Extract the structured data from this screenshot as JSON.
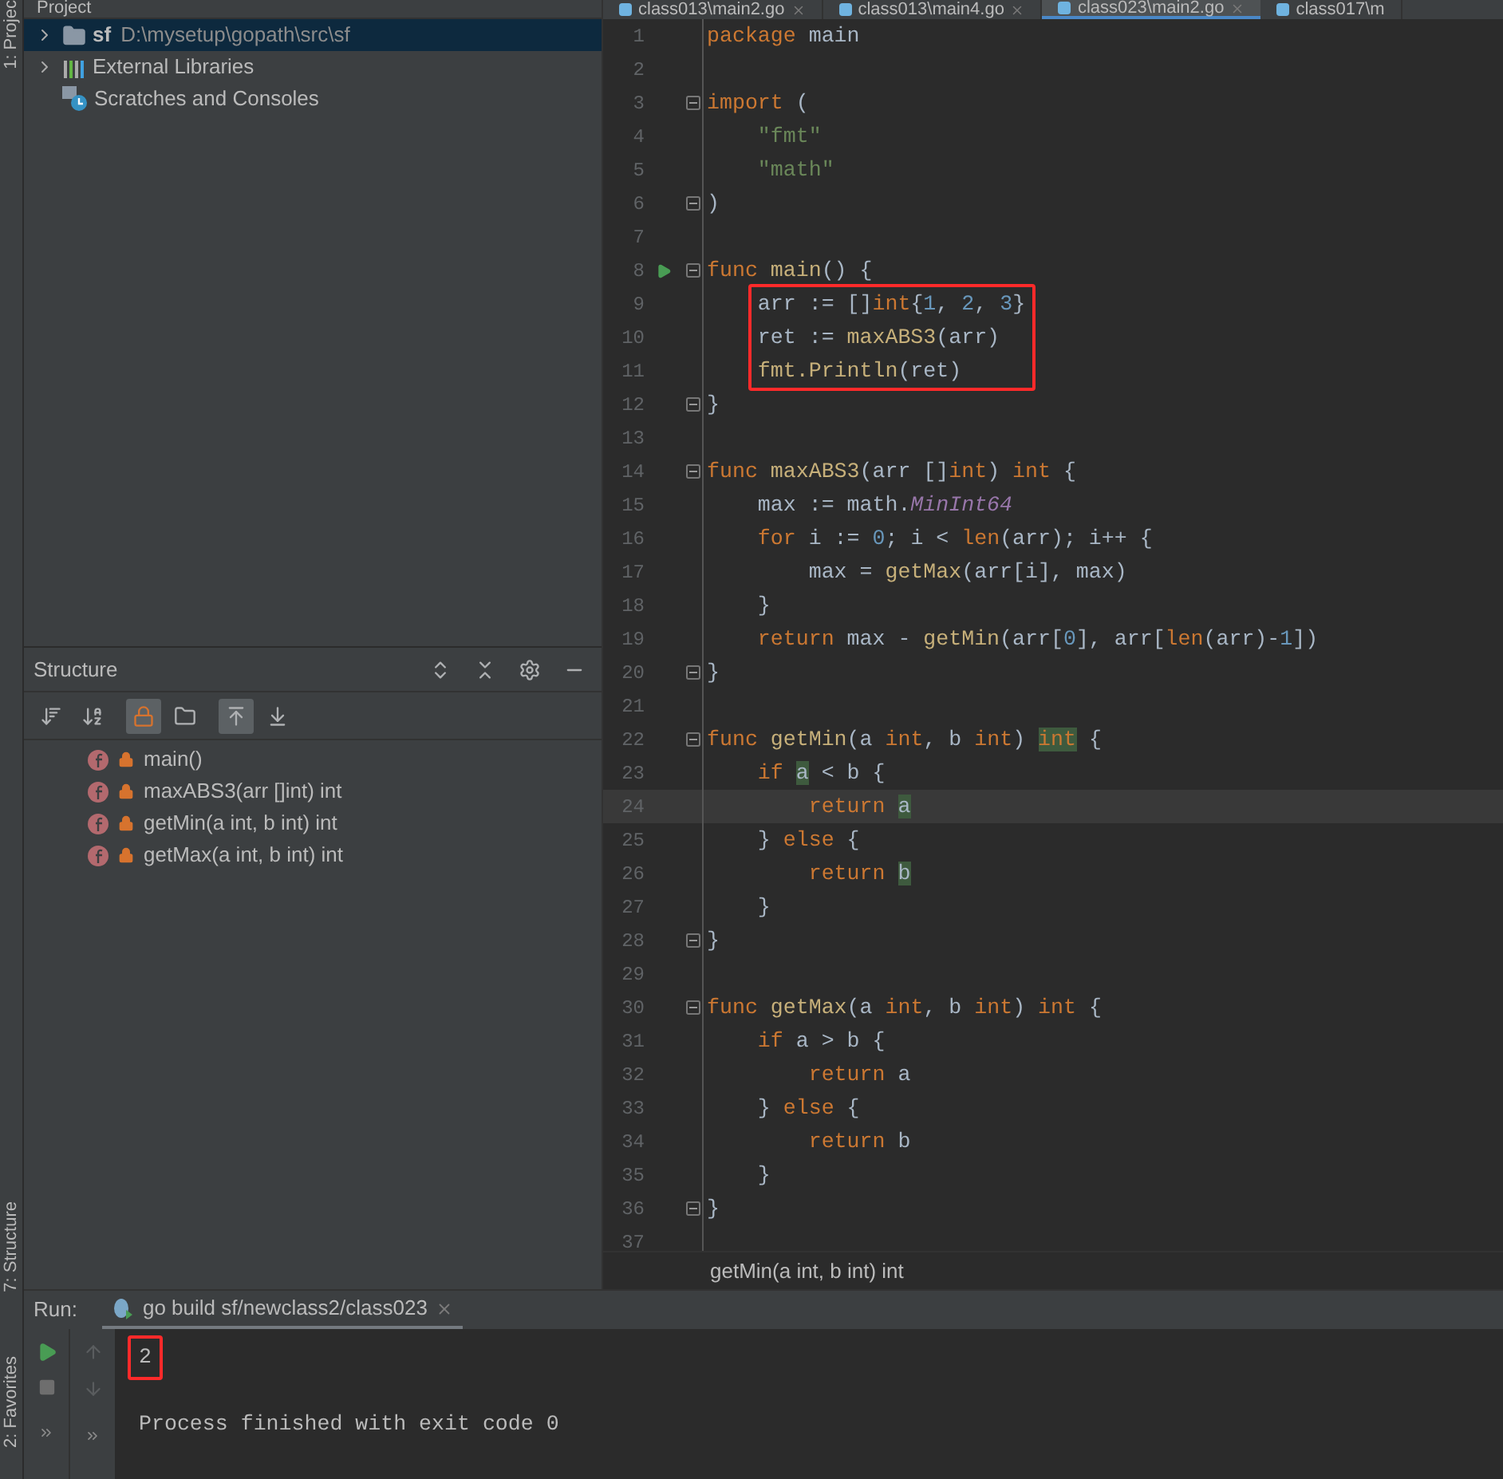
{
  "side_strip": [
    {
      "label": "1: Projec"
    },
    {
      "label": "7: Structure"
    },
    {
      "label": "2: Favorites"
    }
  ],
  "project": {
    "title": "Project",
    "tree": [
      {
        "kind": "module",
        "label": "sf",
        "path": "D:\\mysetup\\gopath\\src\\sf",
        "selected": true,
        "expandable": true
      },
      {
        "kind": "libraries",
        "label": "External Libraries",
        "selected": false,
        "expandable": true
      },
      {
        "kind": "scratches",
        "label": "Scratches and Consoles",
        "selected": false,
        "expandable": false
      }
    ]
  },
  "structure": {
    "title": "Structure",
    "toolbar": [
      {
        "kind": "sort-visibility",
        "selected": false
      },
      {
        "kind": "sort-alpha",
        "selected": false
      },
      {
        "kind": "lock",
        "selected": true
      },
      {
        "kind": "folder",
        "selected": false
      },
      {
        "kind": "scroll-from",
        "selected": true
      },
      {
        "kind": "scroll-to",
        "selected": false
      }
    ],
    "items": [
      {
        "label": "main()"
      },
      {
        "label": "maxABS3(arr []int) int"
      },
      {
        "label": "getMin(a int, b int) int"
      },
      {
        "label": "getMax(a int, b int) int"
      }
    ]
  },
  "tabs": [
    {
      "label": "class013\\main2.go",
      "selected": false
    },
    {
      "label": "class013\\main4.go",
      "selected": false
    },
    {
      "label": "class023\\main2.go",
      "selected": true
    },
    {
      "label": "class017\\m",
      "selected": false
    }
  ],
  "code": [
    {
      "num": "1",
      "tokens": [
        {
          "kind": "kw",
          "text": "package"
        },
        {
          "kind": "plain",
          "text": " main"
        }
      ]
    },
    {
      "num": "2"
    },
    {
      "num": "3",
      "fold_start": true,
      "tokens": [
        {
          "kind": "kw",
          "text": "import"
        },
        {
          "kind": "plain",
          "text": " ("
        }
      ]
    },
    {
      "num": "4",
      "tokens": [
        {
          "kind": "str",
          "text": "    \"fmt\""
        }
      ]
    },
    {
      "num": "5",
      "tokens": [
        {
          "kind": "str",
          "text": "    \"math\""
        }
      ]
    },
    {
      "num": "6",
      "fold_end": true,
      "tokens": [
        {
          "kind": "plain",
          "text": ")"
        }
      ]
    },
    {
      "num": "7"
    },
    {
      "num": "8",
      "fold_start": true,
      "run": true,
      "tokens": [
        {
          "kind": "kw",
          "text": "func "
        },
        {
          "kind": "fn",
          "text": "main"
        },
        {
          "kind": "plain",
          "text": "() {"
        }
      ]
    },
    {
      "num": "9",
      "framed": true,
      "tokens": [
        {
          "kind": "plain",
          "text": "    arr := []"
        },
        {
          "kind": "kw",
          "text": "int"
        },
        {
          "kind": "plain",
          "text": "{"
        },
        {
          "kind": "num",
          "text": "1"
        },
        {
          "kind": "plain",
          "text": ", "
        },
        {
          "kind": "num",
          "text": "2"
        },
        {
          "kind": "plain",
          "text": ", "
        },
        {
          "kind": "num",
          "text": "3"
        },
        {
          "kind": "plain",
          "text": "}"
        }
      ]
    },
    {
      "num": "10",
      "framed": true,
      "tokens": [
        {
          "kind": "plain",
          "text": "    ret := "
        },
        {
          "kind": "fn",
          "text": "maxABS3"
        },
        {
          "kind": "plain",
          "text": "(arr)"
        }
      ]
    },
    {
      "num": "11",
      "framed": true,
      "tokens": [
        {
          "kind": "fn",
          "text": "    fmt.Println"
        },
        {
          "kind": "plain",
          "text": "(ret)"
        }
      ]
    },
    {
      "num": "12",
      "fold_end": true,
      "tokens": [
        {
          "kind": "plain",
          "text": "}"
        }
      ]
    },
    {
      "num": "13"
    },
    {
      "num": "14",
      "fold_start": true,
      "tokens": [
        {
          "kind": "kw",
          "text": "func "
        },
        {
          "kind": "fn",
          "text": "maxABS3"
        },
        {
          "kind": "plain",
          "text": "(arr []"
        },
        {
          "kind": "kw",
          "text": "int"
        },
        {
          "kind": "plain",
          "text": ") "
        },
        {
          "kind": "kw",
          "text": "int"
        },
        {
          "kind": "plain",
          "text": " {"
        }
      ]
    },
    {
      "num": "15",
      "tokens": [
        {
          "kind": "plain",
          "text": "    max := math."
        },
        {
          "kind": "const",
          "text": "MinInt64"
        }
      ]
    },
    {
      "num": "16",
      "tokens": [
        {
          "kind": "kw",
          "text": "    for"
        },
        {
          "kind": "plain",
          "text": " i := "
        },
        {
          "kind": "num",
          "text": "0"
        },
        {
          "kind": "plain",
          "text": "; i < "
        },
        {
          "kind": "kw",
          "text": "len"
        },
        {
          "kind": "plain",
          "text": "(arr); i++ {"
        }
      ]
    },
    {
      "num": "17",
      "tokens": [
        {
          "kind": "plain",
          "text": "        max = "
        },
        {
          "kind": "fn",
          "text": "getMax"
        },
        {
          "kind": "plain",
          "text": "(arr[i], max)"
        }
      ]
    },
    {
      "num": "18",
      "tokens": [
        {
          "kind": "plain",
          "text": "    }"
        }
      ]
    },
    {
      "num": "19",
      "tokens": [
        {
          "kind": "kw",
          "text": "    return"
        },
        {
          "kind": "plain",
          "text": " max - "
        },
        {
          "kind": "fn",
          "text": "getMin"
        },
        {
          "kind": "plain",
          "text": "(arr["
        },
        {
          "kind": "num",
          "text": "0"
        },
        {
          "kind": "plain",
          "text": "], arr["
        },
        {
          "kind": "kw",
          "text": "len"
        },
        {
          "kind": "plain",
          "text": "(arr)-"
        },
        {
          "kind": "num",
          "text": "1"
        },
        {
          "kind": "plain",
          "text": "])"
        }
      ]
    },
    {
      "num": "20",
      "fold_end": true,
      "tokens": [
        {
          "kind": "plain",
          "text": "}"
        }
      ]
    },
    {
      "num": "21"
    },
    {
      "num": "22",
      "fold_start": true,
      "tokens": [
        {
          "kind": "kw",
          "text": "func "
        },
        {
          "kind": "fn",
          "text": "getMin"
        },
        {
          "kind": "plain",
          "text": "(a "
        },
        {
          "kind": "kw",
          "text": "int"
        },
        {
          "kind": "plain",
          "text": ", b "
        },
        {
          "kind": "kw",
          "text": "int"
        },
        {
          "kind": "plain",
          "text": ") "
        },
        {
          "kind": "kw",
          "text": "int",
          "highlighted": true
        },
        {
          "kind": "plain",
          "text": " {"
        }
      ]
    },
    {
      "num": "23",
      "tokens": [
        {
          "kind": "kw",
          "text": "    if "
        },
        {
          "kind": "plain",
          "text": "a",
          "highlighted": true
        },
        {
          "kind": "plain",
          "text": " < b {"
        }
      ]
    },
    {
      "num": "24",
      "current": true,
      "tokens": [
        {
          "kind": "kw",
          "text": "        return "
        },
        {
          "kind": "plain",
          "text": "a",
          "highlighted": true
        }
      ]
    },
    {
      "num": "25",
      "tokens": [
        {
          "kind": "plain",
          "text": "    } "
        },
        {
          "kind": "kw",
          "text": "else"
        },
        {
          "kind": "plain",
          "text": " {"
        }
      ]
    },
    {
      "num": "26",
      "tokens": [
        {
          "kind": "kw",
          "text": "        return "
        },
        {
          "kind": "plain",
          "text": "b",
          "highlighted": true
        }
      ]
    },
    {
      "num": "27",
      "tokens": [
        {
          "kind": "plain",
          "text": "    }"
        }
      ]
    },
    {
      "num": "28",
      "fold_end": true,
      "tokens": [
        {
          "kind": "plain",
          "text": "}"
        }
      ]
    },
    {
      "num": "29"
    },
    {
      "num": "30",
      "fold_start": true,
      "tokens": [
        {
          "kind": "kw",
          "text": "func "
        },
        {
          "kind": "fn",
          "text": "getMax"
        },
        {
          "kind": "plain",
          "text": "(a "
        },
        {
          "kind": "kw",
          "text": "int"
        },
        {
          "kind": "plain",
          "text": ", b "
        },
        {
          "kind": "kw",
          "text": "int"
        },
        {
          "kind": "plain",
          "text": ") "
        },
        {
          "kind": "kw",
          "text": "int"
        },
        {
          "kind": "plain",
          "text": " {"
        }
      ]
    },
    {
      "num": "31",
      "tokens": [
        {
          "kind": "kw",
          "text": "    if"
        },
        {
          "kind": "plain",
          "text": " a > b {"
        }
      ]
    },
    {
      "num": "32",
      "tokens": [
        {
          "kind": "kw",
          "text": "        return"
        },
        {
          "kind": "plain",
          "text": " a"
        }
      ]
    },
    {
      "num": "33",
      "tokens": [
        {
          "kind": "plain",
          "text": "    } "
        },
        {
          "kind": "kw",
          "text": "else"
        },
        {
          "kind": "plain",
          "text": " {"
        }
      ]
    },
    {
      "num": "34",
      "tokens": [
        {
          "kind": "kw",
          "text": "        return"
        },
        {
          "kind": "plain",
          "text": " b"
        }
      ]
    },
    {
      "num": "35",
      "tokens": [
        {
          "kind": "plain",
          "text": "    }"
        }
      ]
    },
    {
      "num": "36",
      "fold_end": true,
      "tokens": [
        {
          "kind": "plain",
          "text": "}"
        }
      ]
    },
    {
      "num": "37"
    }
  ],
  "breadcrumb": "getMin(a int, b int) int",
  "run": {
    "label": "Run:",
    "tab": "go build sf/newclass2/class023",
    "output": [
      {
        "text": "2",
        "framed": true
      },
      {
        "text": "Process finished with exit code 0",
        "framed": false
      }
    ]
  }
}
